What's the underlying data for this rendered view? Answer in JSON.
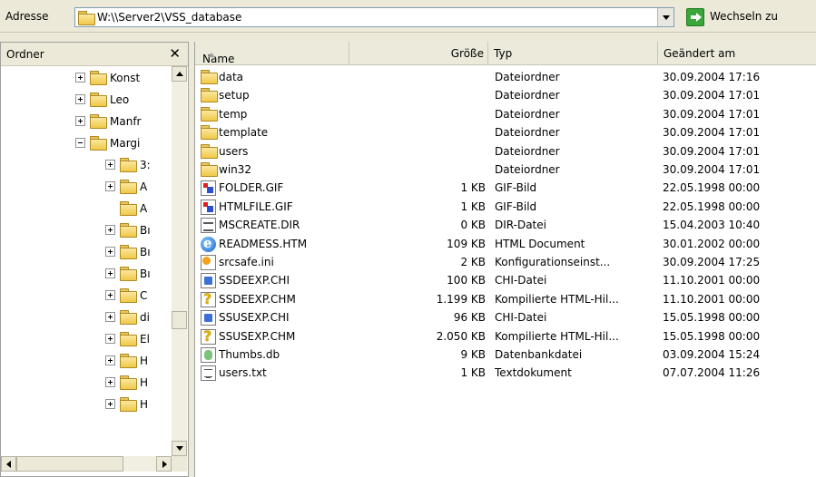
{
  "address_bar": {
    "label": "Adresse",
    "path": "W:\\\\Server2\\VSS_database",
    "go_label": "Wechseln zu"
  },
  "folder_pane": {
    "title": "Ordner",
    "close_glyph": "✕",
    "tree": [
      {
        "label": "Konst",
        "expander": "plus",
        "level": 0
      },
      {
        "label": "Leo",
        "expander": "plus",
        "level": 0
      },
      {
        "label": "Manfr",
        "expander": "plus",
        "level": 0
      },
      {
        "label": "Margi",
        "expander": "minus",
        "level": 0
      },
      {
        "label": "3:",
        "expander": "plus",
        "level": 1
      },
      {
        "label": "A",
        "expander": "plus",
        "level": 1
      },
      {
        "label": "A",
        "expander": "none",
        "level": 1
      },
      {
        "label": "Bı",
        "expander": "plus",
        "level": 1
      },
      {
        "label": "Bı",
        "expander": "plus",
        "level": 1
      },
      {
        "label": "Bı",
        "expander": "plus",
        "level": 1
      },
      {
        "label": "C",
        "expander": "plus",
        "level": 1
      },
      {
        "label": "di",
        "expander": "plus",
        "level": 1
      },
      {
        "label": "El",
        "expander": "plus",
        "level": 1
      },
      {
        "label": "H",
        "expander": "plus",
        "level": 1
      },
      {
        "label": "H",
        "expander": "plus",
        "level": 1
      },
      {
        "label": "H",
        "expander": "plus",
        "level": 1
      }
    ]
  },
  "file_list": {
    "columns": {
      "name": "Name",
      "size": "Größe",
      "type": "Typ",
      "date": "Geändert am"
    },
    "rows": [
      {
        "icon": "folder-icon",
        "name": "data",
        "size": "",
        "type": "Dateiordner",
        "date": "30.09.2004 17:16"
      },
      {
        "icon": "folder-icon",
        "name": "setup",
        "size": "",
        "type": "Dateiordner",
        "date": "30.09.2004 17:01"
      },
      {
        "icon": "folder-icon",
        "name": "temp",
        "size": "",
        "type": "Dateiordner",
        "date": "30.09.2004 17:01"
      },
      {
        "icon": "folder-icon",
        "name": "template",
        "size": "",
        "type": "Dateiordner",
        "date": "30.09.2004 17:01"
      },
      {
        "icon": "folder-icon",
        "name": "users",
        "size": "",
        "type": "Dateiordner",
        "date": "30.09.2004 17:01"
      },
      {
        "icon": "folder-icon",
        "name": "win32",
        "size": "",
        "type": "Dateiordner",
        "date": "30.09.2004 17:01"
      },
      {
        "icon": "gif-image-icon",
        "name": "FOLDER.GIF",
        "size": "1 KB",
        "type": "GIF-Bild",
        "date": "22.05.1998 00:00"
      },
      {
        "icon": "gif-image-icon",
        "name": "HTMLFILE.GIF",
        "size": "1 KB",
        "type": "GIF-Bild",
        "date": "22.05.1998 00:00"
      },
      {
        "icon": "dir-file-icon",
        "name": "MSCREATE.DIR",
        "size": "0 KB",
        "type": "DIR-Datei",
        "date": "15.04.2003 10:40"
      },
      {
        "icon": "html-document-icon",
        "name": "READMESS.HTM",
        "size": "109 KB",
        "type": "HTML Document",
        "date": "30.01.2002 00:00"
      },
      {
        "icon": "config-file-icon",
        "name": "srcsafe.ini",
        "size": "2 KB",
        "type": "Konfigurationseinst...",
        "date": "30.09.2004 17:25"
      },
      {
        "icon": "chi-file-icon",
        "name": "SSDEEXP.CHI",
        "size": "100 KB",
        "type": "CHI-Datei",
        "date": "11.10.2001 00:00"
      },
      {
        "icon": "help-file-icon",
        "name": "SSDEEXP.CHM",
        "size": "1.199 KB",
        "type": "Kompilierte HTML-Hil...",
        "date": "11.10.2001 00:00"
      },
      {
        "icon": "chi-file-icon",
        "name": "SSUSEXP.CHI",
        "size": "96 KB",
        "type": "CHI-Datei",
        "date": "15.05.1998 00:00"
      },
      {
        "icon": "help-file-icon",
        "name": "SSUSEXP.CHM",
        "size": "2.050 KB",
        "type": "Kompilierte HTML-Hil...",
        "date": "15.05.1998 00:00"
      },
      {
        "icon": "database-file-icon",
        "name": "Thumbs.db",
        "size": "9 KB",
        "type": "Datenbankdatei",
        "date": "03.09.2004 15:24"
      },
      {
        "icon": "text-file-icon",
        "name": "users.txt",
        "size": "1 KB",
        "type": "Textdokument",
        "date": "07.07.2004 11:26"
      }
    ]
  }
}
